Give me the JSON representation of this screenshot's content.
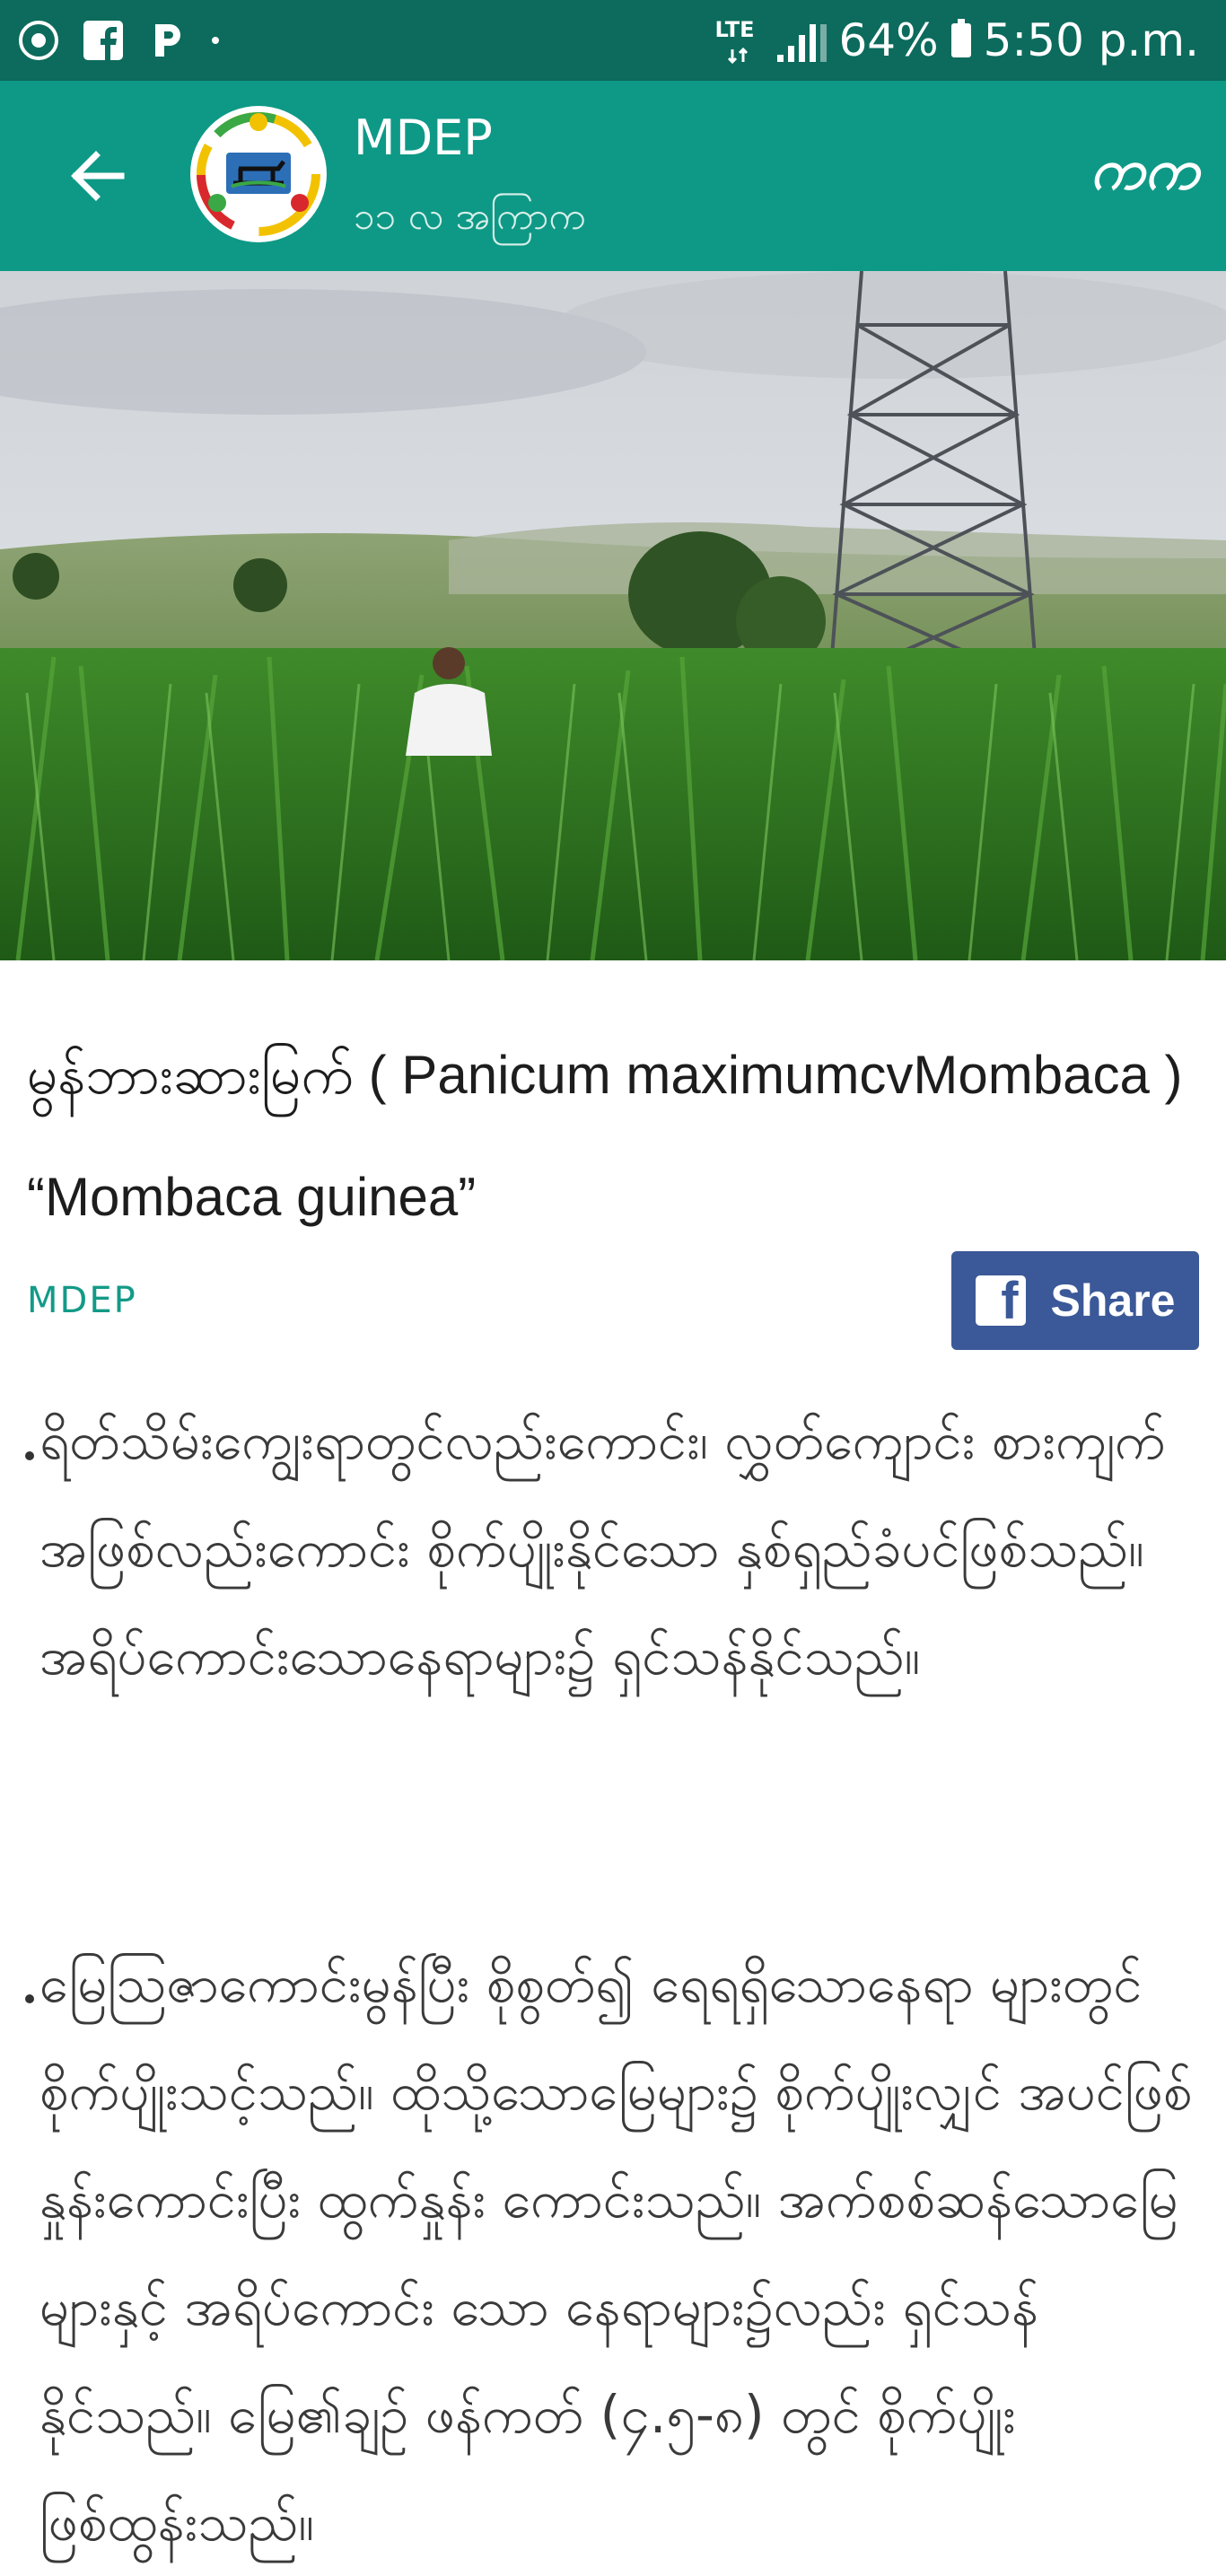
{
  "status_bar": {
    "network": "LTE",
    "battery": "64%",
    "time": "5:50 p.m.",
    "icons": [
      "app-notification-icon",
      "facebook-icon",
      "pinterest-icon",
      "more-dot-icon",
      "lte-icon",
      "signal-icon",
      "battery-icon"
    ]
  },
  "app_bar": {
    "title": "MDEP",
    "subtitle": "၁၁ လ အကြာက",
    "font_toggle": "ကက",
    "back_icon": "arrow-back-icon",
    "accent_color": "#0e9986"
  },
  "article": {
    "title": "မွန်ဘားဆားမြက် ( Panicum maximumcvMombaca ) “Mombaca guinea”",
    "source": "MDEP",
    "share_label": "Share",
    "share_color": "#3b5998",
    "paragraphs": [
      "ရိတ်သိမ်းကျွေးရာတွင်လည်းကောင်း၊ လွှတ်ကျောင်း စားကျက်အဖြစ်လည်းကောင်း စိုက်ပျိုးနိုင်သော နှစ်ရှည်ခံပင်ဖြစ်သည်။ အရိပ်ကောင်းသောနေရာများ၌ ရှင်သန်နိုင်သည်။",
      "မြေသြဇာကောင်းမွန်ပြီး စိုစွတ်၍ ရေရရှိသောနေရာ များတွင် စိုက်ပျိုးသင့်သည်။ ထိုသို့သောမြေများ၌ စိုက်ပျိုးလျှင် အပင်ဖြစ်နှုန်းကောင်းပြီး ထွက်နှုန်း ကောင်းသည်။ အက်စစ်ဆန်သောမြေများနှင့် အရိပ်ကောင်း သော နေရာများ၌လည်း ရှင်သန်နိုင်သည်။ မြေ၏ချဉ် ဖန်ကတ် (၄.၅-၈) တွင် စိုက်ပျိုးဖြစ်ထွန်းသည်။"
    ]
  }
}
